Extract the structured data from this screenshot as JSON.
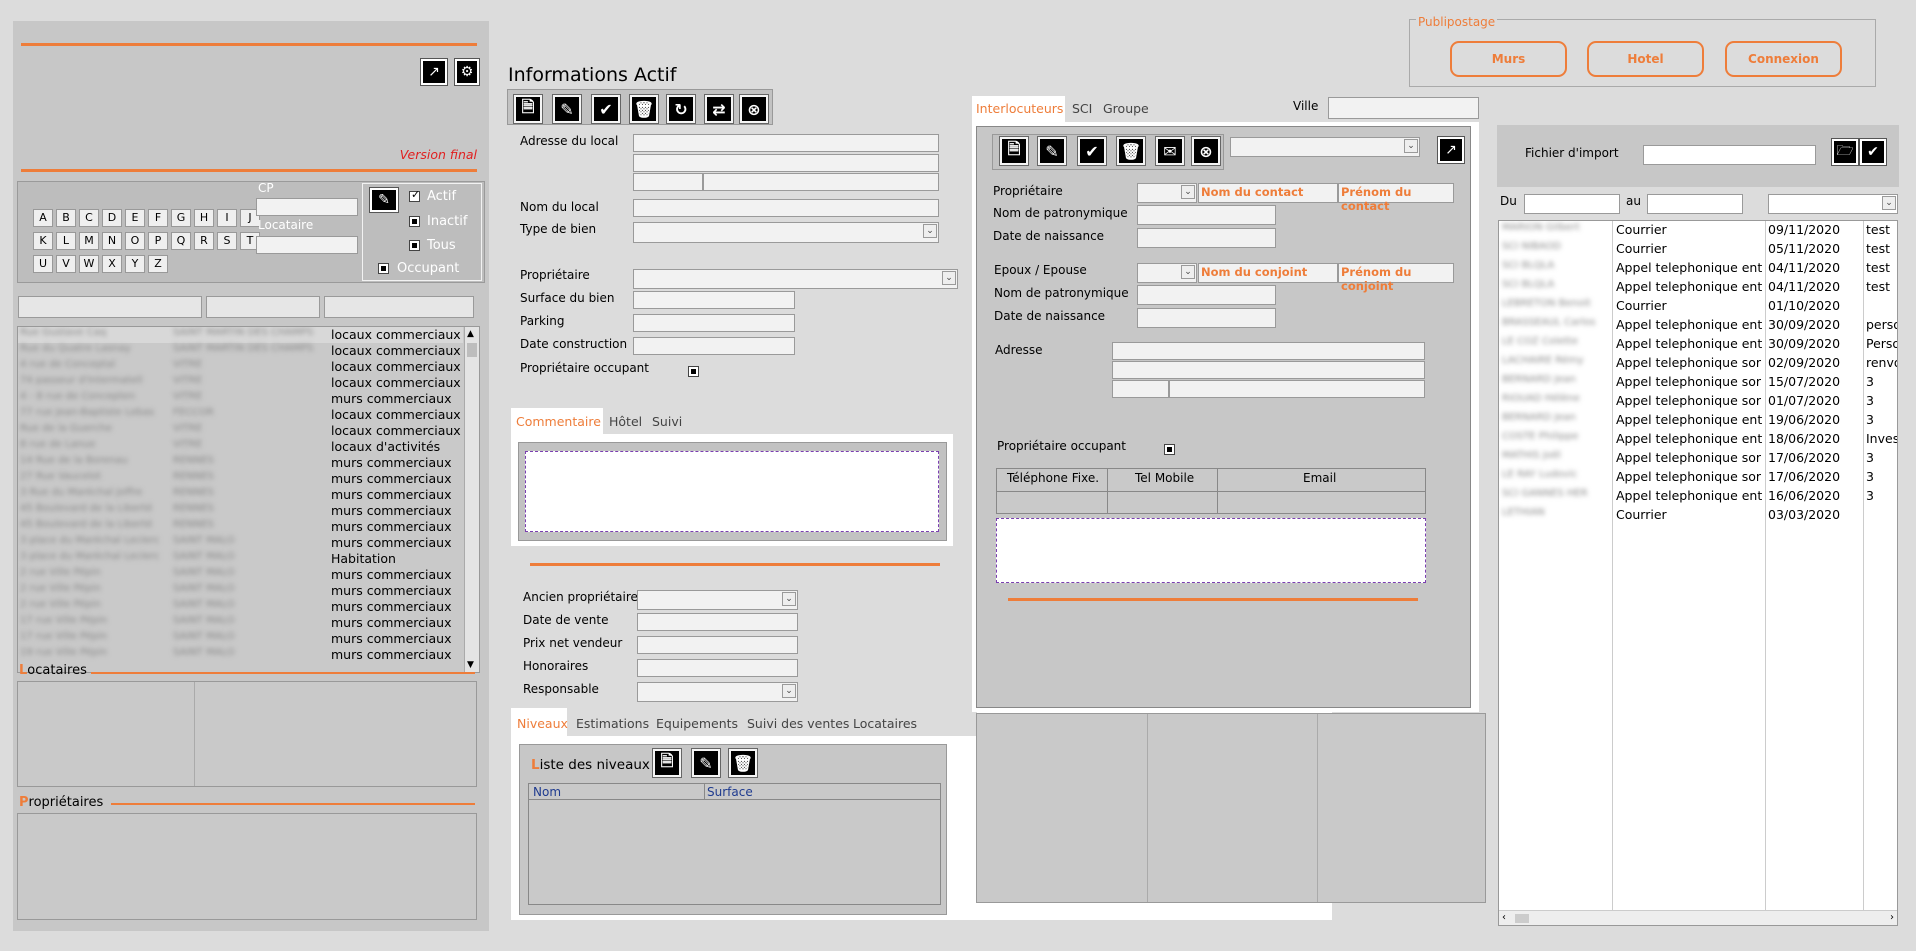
{
  "left": {
    "version": "Version final",
    "alpha": [
      "A",
      "B",
      "C",
      "D",
      "E",
      "F",
      "G",
      "H",
      "I",
      "J",
      "K",
      "L",
      "M",
      "N",
      "O",
      "P",
      "Q",
      "R",
      "S",
      "T",
      "U",
      "V",
      "W",
      "X",
      "Y",
      "Z"
    ],
    "cp_label": "CP",
    "locataire_label": "Locataire",
    "filters": [
      "Actif",
      "Inactif",
      "Tous",
      "Occupant"
    ],
    "rows": [
      {
        "a": "Rue Gustave Caq",
        "b": "SAINT MARTIN DES CHAMPS",
        "c": "locaux commerciaux"
      },
      {
        "a": "Rue du Quatre Lasnay",
        "b": "SAINT MARTIN DES CHAMPS",
        "c": "locaux commerciaux"
      },
      {
        "a": "4 rue de Conceptal",
        "b": "VITRE",
        "c": "locaux commerciaux"
      },
      {
        "a": "74 passeur d'Intermatell",
        "b": "VITRE",
        "c": "locaux commerciaux"
      },
      {
        "a": "4 - 8 rue de Concepten",
        "b": "VITRE",
        "c": "murs commerciaux"
      },
      {
        "a": "77 rue Jean-Baptiste Lebas",
        "b": "FECCOR",
        "c": "locaux commerciaux"
      },
      {
        "a": "Rue de la Guerche",
        "b": "VITRE",
        "c": "locaux commerciaux"
      },
      {
        "a": "8 rue de Lanue",
        "b": "VITRE",
        "c": "locaux d'activités"
      },
      {
        "a": "14 Rue de la Borenau",
        "b": "RENNES",
        "c": "murs commerciaux"
      },
      {
        "a": "27 Rue Vaucelot",
        "b": "RENNES",
        "c": "murs commerciaux"
      },
      {
        "a": "3 Rue du Maréchal Joffre",
        "b": "RENNES",
        "c": "murs commerciaux"
      },
      {
        "a": "45 Boulevard de la Liberté",
        "b": "RENNES",
        "c": "murs commerciaux"
      },
      {
        "a": "45 Boulevard de la Liberté",
        "b": "RENNES",
        "c": "murs commerciaux"
      },
      {
        "a": "3 place du Maréchal Leclerc",
        "b": "SAINT MALO",
        "c": "murs commerciaux"
      },
      {
        "a": "3 place du Maréchal Leclerc",
        "b": "SAINT MALO",
        "c": "Habitation"
      },
      {
        "a": "2 rue Ville Pépin",
        "b": "SAINT MALO",
        "c": "murs commerciaux"
      },
      {
        "a": "2 rue Ville Pépin",
        "b": "SAINT MALO",
        "c": "murs commerciaux"
      },
      {
        "a": "2 rue Ville Pépin",
        "b": "SAINT MALO",
        "c": "murs commerciaux"
      },
      {
        "a": "17 rue Ville Pépin",
        "b": "SAINT MALO",
        "c": "murs commerciaux"
      },
      {
        "a": "17 rue Ville Pépin",
        "b": "SAINT MALO",
        "c": "murs commerciaux"
      },
      {
        "a": "19 rue Ville Pépin",
        "b": "SAINT MALO",
        "c": "murs commerciaux"
      }
    ],
    "locataires_title": "ocataires",
    "locataires_first": "L",
    "proprietaires_title": "ropriétaires",
    "proprietaires_first": "P"
  },
  "info": {
    "title": "Informations Actif",
    "adresse": "Adresse du local",
    "nom": "Nom du local",
    "type": "Type de bien",
    "proprietaire": "Propriétaire",
    "surface": "Surface du bien",
    "parking": "Parking",
    "date_construction": "Date construction",
    "prop_occupant": "Propriétaire occupant",
    "tabs": [
      "Commentaire",
      "Hôtel",
      "Suivi"
    ],
    "ancien": "Ancien propriétaire",
    "date_vente": "Date de vente",
    "prix": "Prix net vendeur",
    "honoraires": "Honoraires",
    "responsable": "Responsable",
    "tabs2": [
      "Niveaux",
      "Estimations",
      "Equipements",
      "Suivi des ventes",
      "Locataires"
    ],
    "niveaux_title_first": "L",
    "niveaux_title": "iste des niveaux",
    "col_nom": "Nom",
    "col_surface": "Surface"
  },
  "inter": {
    "tabs": [
      "Interlocuteurs",
      "SCI",
      "Groupe"
    ],
    "ville": "Ville",
    "proprietaire": "Propriétaire",
    "nom_contact": "Nom du contact",
    "prenom_contact": "Prénom du contact",
    "patronyme": "Nom de patronymique",
    "naissance": "Date de naissance",
    "epoux": "Epoux / Epouse",
    "nom_conjoint": "Nom du conjoint",
    "prenom_conjoint": "Prénom du conjoint",
    "patronyme2": "Nom de patronymique",
    "naissance2": "Date de naissance",
    "adresse": "Adresse",
    "prop_occupant": "Propriétaire occupant",
    "tel_fixe": "Téléphone  Fixe.",
    "tel_mobile": "Tel Mobile",
    "email": "Email"
  },
  "publi": {
    "title": "Publipostage",
    "buttons": [
      "Murs",
      "Hotel",
      "Connexion"
    ]
  },
  "import": {
    "label": "Fichier d'import",
    "du": "Du",
    "au": "au",
    "rows": [
      {
        "name": "MARION Gilbert",
        "type": "Courrier",
        "date": "09/11/2020",
        "note": "test"
      },
      {
        "name": "SCI NIBAOD",
        "type": "Courrier",
        "date": "05/11/2020",
        "note": "test"
      },
      {
        "name": "SCI BLQLA",
        "type": "Appel telephonique ent",
        "date": "04/11/2020",
        "note": "test"
      },
      {
        "name": "SCI BLQLA",
        "type": "Appel telephonique ent",
        "date": "04/11/2020",
        "note": "test"
      },
      {
        "name": "LEBRETON Benoit",
        "type": "Courrier",
        "date": "01/10/2020",
        "note": ""
      },
      {
        "name": "BRASSEAUL Carlos",
        "type": "Appel telephonique ent",
        "date": "30/09/2020",
        "note": "perso"
      },
      {
        "name": "LE COZ Colette",
        "type": "Appel telephonique ent",
        "date": "30/09/2020",
        "note": "Perso"
      },
      {
        "name": "LACHAIRE Rémy",
        "type": "Appel telephonique sor",
        "date": "02/09/2020",
        "note": "renvo"
      },
      {
        "name": "BERNARD Jean",
        "type": "Appel telephonique sor",
        "date": "15/07/2020",
        "note": "3"
      },
      {
        "name": "RIOUAD Hélène",
        "type": "Appel telephonique sor",
        "date": "01/07/2020",
        "note": "3"
      },
      {
        "name": "BERNARD Jean",
        "type": "Appel telephonique ent",
        "date": "19/06/2020",
        "note": "3"
      },
      {
        "name": "COSTE Philippe",
        "type": "Appel telephonique ent",
        "date": "18/06/2020",
        "note": "Inves"
      },
      {
        "name": "MATHIS Joël",
        "type": "Appel telephonique sor",
        "date": "17/06/2020",
        "note": "3"
      },
      {
        "name": "LE RAY Ludovic",
        "type": "Appel telephonique sor",
        "date": "17/06/2020",
        "note": "3"
      },
      {
        "name": "SCI GANNES HER",
        "type": "Appel telephonique ent",
        "date": "16/06/2020",
        "note": "3"
      },
      {
        "name": "LETHIAN",
        "type": "Courrier",
        "date": "03/03/2020",
        "note": ""
      }
    ]
  },
  "colors": {
    "accent": "#ee7d3a",
    "panel": "#c7c7c7"
  }
}
